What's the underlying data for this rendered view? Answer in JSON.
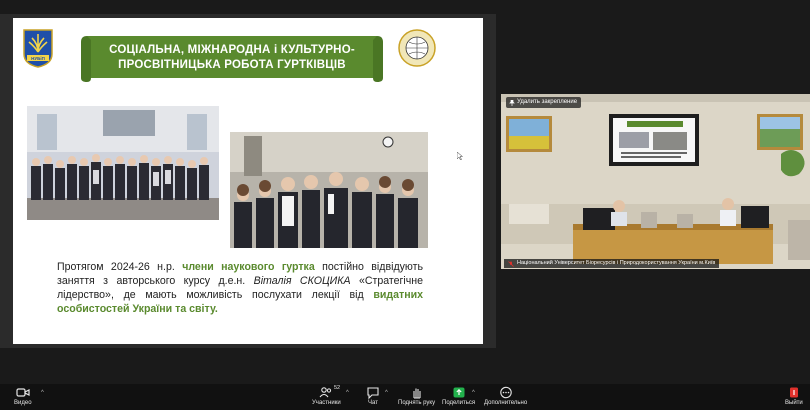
{
  "slide": {
    "title_line1": "СОЦІАЛЬНА, МІЖНАРОДНА і КУЛЬТУРНО-",
    "title_line2": "ПРОСВІТНИЦЬКА РОБОТА ГУРТКІВЦІВ",
    "left_logo_text": "НУБіП",
    "text_parts": [
      {
        "t": "Протягом 2024-26 н.р. ",
        "s": ""
      },
      {
        "t": "члени наукового гуртка",
        "s": "g"
      },
      {
        "t": " постійно відвідують заняття з авторського курсу д.е.н. ",
        "s": ""
      },
      {
        "t": "Віталія СКОЦИКА",
        "s": "i"
      },
      {
        "t": " «Стратегічне лідерство», де мають можливість послухати лекції від ",
        "s": ""
      },
      {
        "t": "видатних особистостей України та світу.",
        "s": "g"
      }
    ]
  },
  "video": {
    "pin_label": "Удалить закрепление",
    "caption": "Національний Університет Біоресурсів і Природокористування України м.Київ"
  },
  "toolbar": {
    "video_label": "Видео",
    "participants_label": "Участники",
    "participants_count": "52",
    "chat_label": "Чат",
    "raise_hand_label": "Поднять руку",
    "share_label": "Поделиться",
    "more_label": "Дополнительно",
    "leave_label": "Выйти"
  },
  "colors": {
    "banner_green": "#5a8a2e",
    "share_green": "#22b14c",
    "leave_red": "#e0312c"
  }
}
